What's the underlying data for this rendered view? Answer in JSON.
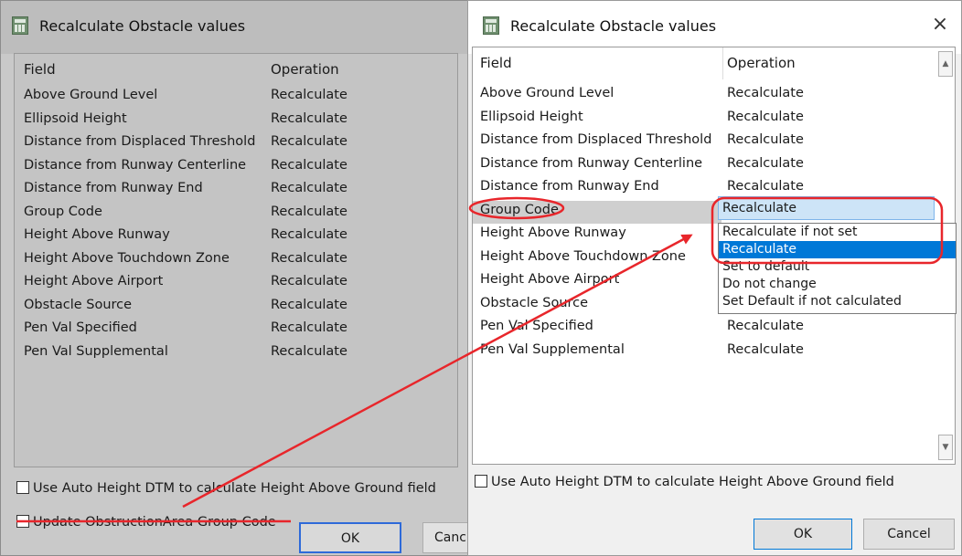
{
  "left_dialog": {
    "title": "Recalculate Obstacle values",
    "headers": {
      "field": "Field",
      "operation": "Operation"
    },
    "rows": [
      {
        "field": "Above Ground Level",
        "operation": "Recalculate"
      },
      {
        "field": "Ellipsoid Height",
        "operation": "Recalculate"
      },
      {
        "field": "Distance from Displaced Threshold",
        "operation": "Recalculate"
      },
      {
        "field": "Distance from Runway Centerline",
        "operation": "Recalculate"
      },
      {
        "field": "Distance from Runway End",
        "operation": "Recalculate"
      },
      {
        "field": "Group Code",
        "operation": "Recalculate"
      },
      {
        "field": "Height Above Runway",
        "operation": "Recalculate"
      },
      {
        "field": "Height Above Touchdown Zone",
        "operation": "Recalculate"
      },
      {
        "field": "Height Above Airport",
        "operation": "Recalculate"
      },
      {
        "field": "Obstacle Source",
        "operation": "Recalculate"
      },
      {
        "field": "Pen Val Specified",
        "operation": "Recalculate"
      },
      {
        "field": "Pen Val Supplemental",
        "operation": "Recalculate"
      }
    ],
    "auto_height_label": "Use Auto Height DTM to calculate Height Above Ground field",
    "update_group_code_label": "Update ObstructionArea Group Code",
    "ok_label": "OK",
    "cancel_label": "Canc"
  },
  "right_dialog": {
    "title": "Recalculate Obstacle values",
    "close_glyph": "×",
    "headers": {
      "field": "Field",
      "operation": "Operation"
    },
    "rows": [
      {
        "field": "Above Ground Level",
        "operation": "Recalculate"
      },
      {
        "field": "Ellipsoid Height",
        "operation": "Recalculate"
      },
      {
        "field": "Distance from Displaced Threshold",
        "operation": "Recalculate"
      },
      {
        "field": "Distance from Runway Centerline",
        "operation": "Recalculate"
      },
      {
        "field": "Distance from Runway End",
        "operation": "Recalculate"
      },
      {
        "field": "Group Code",
        "operation": "Recalculate"
      },
      {
        "field": "Height Above Runway",
        "operation": ""
      },
      {
        "field": "Height Above Touchdown Zone",
        "operation": ""
      },
      {
        "field": "Height Above Airport",
        "operation": ""
      },
      {
        "field": "Obstacle Source",
        "operation": ""
      },
      {
        "field": "Pen Val Specified",
        "operation": "Recalculate"
      },
      {
        "field": "Pen Val Supplemental",
        "operation": "Recalculate"
      }
    ],
    "dropdown_options": [
      "Recalculate if not set",
      "Recalculate",
      "Set to default",
      "Do not change",
      "Set Default if not calculated"
    ],
    "dropdown_selected": "Recalculate",
    "auto_height_label": "Use Auto Height DTM to calculate Height Above Ground field",
    "ok_label": "OK",
    "cancel_label": "Cancel"
  },
  "colors": {
    "annotation_red": "#e8262b",
    "selection_blue": "#0078d7",
    "highlight_row": "#cde4f7"
  }
}
